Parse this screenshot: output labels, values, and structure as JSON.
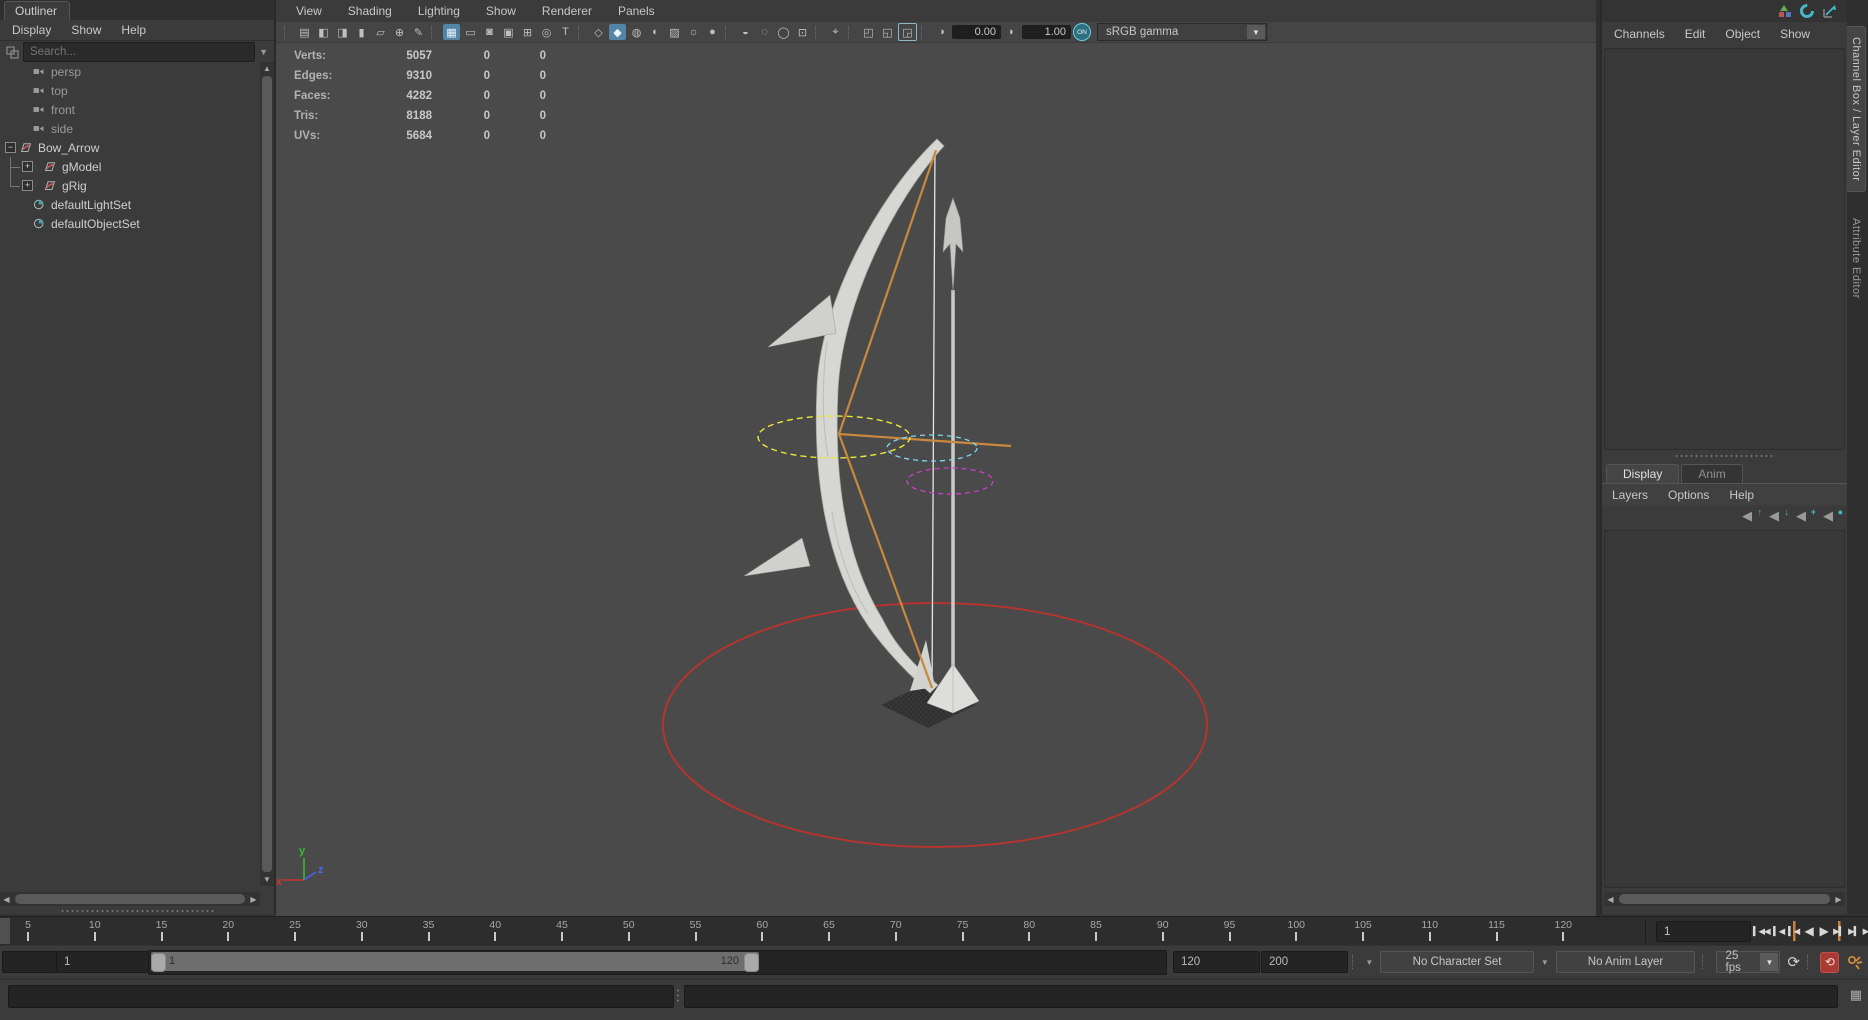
{
  "colors": {
    "accent_teal": "#5285a6",
    "manip_yellow": "#e8e83a",
    "manip_cyan": "#7fd8f0",
    "manip_magenta": "#cc3fcc",
    "selected_orange": "#c8893e",
    "ground_circle_red": "#b5342e",
    "autokey_red": "#a83b33",
    "key_tick_orange": "#c8803c"
  },
  "outliner": {
    "title": "Outliner",
    "menus": [
      "Display",
      "Show",
      "Help"
    ],
    "search_placeholder": "Search...",
    "items": [
      {
        "label": "persp",
        "icon": "camera",
        "dim": true
      },
      {
        "label": "top",
        "icon": "camera",
        "dim": true
      },
      {
        "label": "front",
        "icon": "camera",
        "dim": true
      },
      {
        "label": "side",
        "icon": "camera",
        "dim": true
      },
      {
        "label": "Bow_Arrow",
        "icon": "transform",
        "expander": "minus"
      },
      {
        "label": "gModel",
        "icon": "transform",
        "expander": "plus",
        "child": true
      },
      {
        "label": "gRig",
        "icon": "transform",
        "expander": "plus",
        "child": true,
        "last": true
      },
      {
        "label": "defaultLightSet",
        "icon": "set"
      },
      {
        "label": "defaultObjectSet",
        "icon": "set"
      }
    ]
  },
  "viewport": {
    "menus": [
      "View",
      "Shading",
      "Lighting",
      "Show",
      "Renderer",
      "Panels"
    ],
    "toolbar": {
      "exposure": "0.00",
      "gamma": "1.00",
      "color_on": "ON",
      "color_transform": "sRGB gamma",
      "items": [
        {
          "t": "sep"
        },
        {
          "t": "i",
          "n": "select-camera-icon",
          "g": "▤"
        },
        {
          "t": "i",
          "n": "lock-camera-icon",
          "g": "◧"
        },
        {
          "t": "i",
          "n": "camera-attributes-icon",
          "g": "◨"
        },
        {
          "t": "i",
          "n": "bookmark-icon",
          "g": "▮"
        },
        {
          "t": "i",
          "n": "image-plane-icon",
          "g": "▱"
        },
        {
          "t": "i",
          "n": "pan-zoom-icon",
          "g": "⊕"
        },
        {
          "t": "i",
          "n": "grease-pencil-icon",
          "g": "✎"
        },
        {
          "t": "sep"
        },
        {
          "t": "i",
          "n": "grid-icon",
          "g": "▦",
          "a": 1
        },
        {
          "t": "i",
          "n": "film-gate-icon",
          "g": "▭"
        },
        {
          "t": "i",
          "n": "resolution-gate-icon",
          "g": "◙"
        },
        {
          "t": "i",
          "n": "gate-mask-icon",
          "g": "▣"
        },
        {
          "t": "i",
          "n": "field-chart-icon",
          "g": "⊞"
        },
        {
          "t": "i",
          "n": "safe-action-icon",
          "g": "◎"
        },
        {
          "t": "i",
          "n": "safe-title-icon",
          "g": "T"
        },
        {
          "t": "sep"
        },
        {
          "t": "i",
          "n": "wireframe-icon",
          "g": "◇"
        },
        {
          "t": "i",
          "n": "smooth-shade-icon",
          "g": "◆",
          "a": 1
        },
        {
          "t": "i",
          "n": "textured-icon",
          "g": "◍"
        },
        {
          "t": "i",
          "n": "use-default-material-icon",
          "g": "◐"
        },
        {
          "t": "i",
          "n": "xray-icon",
          "g": "▨"
        },
        {
          "t": "i",
          "n": "lighting-icon",
          "g": "☼"
        },
        {
          "t": "i",
          "n": "shadows-icon",
          "g": "●"
        },
        {
          "t": "sep"
        },
        {
          "t": "i",
          "n": "occlusion-icon",
          "g": "◒"
        },
        {
          "t": "i",
          "n": "motion-blur-icon",
          "g": "◌"
        },
        {
          "t": "i",
          "n": "anti-aliasing-icon",
          "g": "◯"
        },
        {
          "t": "i",
          "n": "depth-peeling-icon",
          "g": "⊡"
        },
        {
          "t": "sep"
        },
        {
          "t": "i",
          "n": "isolate-select-icon",
          "g": "⌖"
        },
        {
          "t": "sep"
        },
        {
          "t": "i",
          "n": "frame-all-icon",
          "g": "◰"
        },
        {
          "t": "i",
          "n": "frame-selection-icon",
          "g": "◱"
        },
        {
          "t": "i",
          "n": "viewport-renderer-icon",
          "g": "◲",
          "b": 1
        },
        {
          "t": "sep"
        },
        {
          "t": "i",
          "n": "exposure-icon",
          "g": "◑"
        },
        {
          "t": "f",
          "n": "exposure-field",
          "bind": "exposure"
        },
        {
          "t": "i",
          "n": "contrast-icon",
          "g": "◗"
        },
        {
          "t": "f",
          "n": "gamma-field",
          "bind": "gamma"
        },
        {
          "t": "on",
          "n": "color-management-toggle"
        },
        {
          "t": "dd",
          "n": "view-transform-select",
          "bind": "color_transform"
        }
      ]
    },
    "hud": {
      "rows": [
        {
          "label": "Verts:",
          "v1": "5057",
          "v2": "0",
          "v3": "0"
        },
        {
          "label": "Edges:",
          "v1": "9310",
          "v2": "0",
          "v3": "0"
        },
        {
          "label": "Faces:",
          "v1": "4282",
          "v2": "0",
          "v3": "0"
        },
        {
          "label": "Tris:",
          "v1": "8188",
          "v2": "0",
          "v3": "0"
        },
        {
          "label": "UVs:",
          "v1": "5684",
          "v2": "0",
          "v3": "0"
        }
      ]
    },
    "axis": {
      "x": "x",
      "y": "y",
      "z": "z"
    }
  },
  "channel_box": {
    "menus": [
      "Channels",
      "Edit",
      "Object",
      "Show"
    ]
  },
  "layer_editor": {
    "tabs": [
      {
        "label": "Display",
        "active": true
      },
      {
        "label": "Anim",
        "active": false
      }
    ],
    "menus": [
      "Layers",
      "Options",
      "Help"
    ],
    "icons": [
      {
        "name": "move-layer-up-icon",
        "glyph": "↑"
      },
      {
        "name": "move-layer-down-icon",
        "glyph": "↓"
      },
      {
        "name": "new-empty-layer-icon",
        "glyph": "+"
      },
      {
        "name": "new-layer-from-selected-icon",
        "glyph": "●"
      }
    ]
  },
  "side_tabs": [
    {
      "label": "Channel Box / Layer Editor",
      "active": true
    },
    {
      "label": "Attribute Editor",
      "active": false
    }
  ],
  "timeline": {
    "tick_start": 5,
    "tick_end": 120,
    "tick_step": 5,
    "current_frame": "1"
  },
  "playback": [
    {
      "name": "go-to-start-button",
      "glyph": "▍◀◀"
    },
    {
      "name": "step-back-frame-button",
      "glyph": "▍◀"
    },
    {
      "name": "step-back-key-button",
      "glyph": "▍◀",
      "key": true
    },
    {
      "name": "play-backwards-button",
      "glyph": "◀",
      "big": true
    },
    {
      "name": "play-forwards-button",
      "glyph": "▶",
      "big": true
    },
    {
      "name": "step-forward-key-button",
      "glyph": "▶▍",
      "key": true
    },
    {
      "name": "step-forward-frame-button",
      "glyph": "▶▍"
    },
    {
      "name": "go-to-end-button",
      "glyph": "▶▶▍"
    }
  ],
  "range": {
    "anim_start_field": "",
    "playback_start_field": "1",
    "range_start_label": "1",
    "range_end_label": "120",
    "playback_end_field": "120",
    "anim_end_field": "200",
    "character_set": "No Character Set",
    "anim_layer": "No Anim Layer",
    "fps": "25 fps"
  }
}
